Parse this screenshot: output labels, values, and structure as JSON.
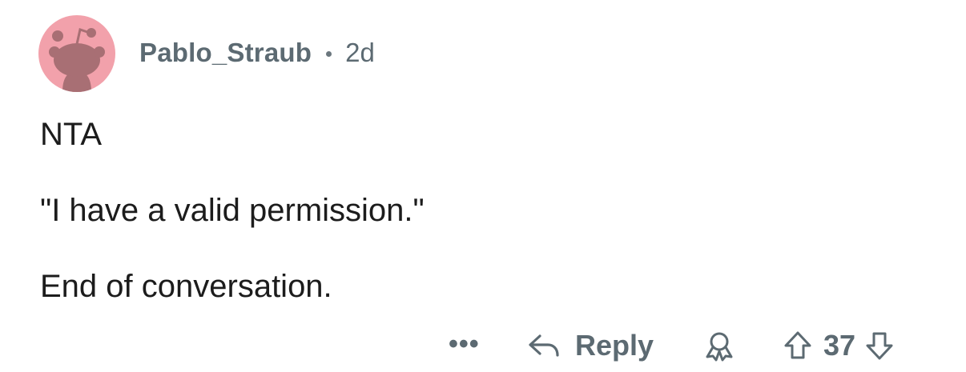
{
  "comment": {
    "author": "Pablo_Straub",
    "age": "2d",
    "paragraphs": [
      "NTA",
      "\"I have a valid permission.\"",
      "End of conversation."
    ]
  },
  "actions": {
    "more_label": "•••",
    "reply_label": "Reply",
    "score": "37",
    "icons": [
      "more-icon",
      "reply-arrow-icon",
      "award-icon",
      "upvote-icon",
      "downvote-icon"
    ]
  },
  "colors": {
    "avatar_bg": "#f2a1ab",
    "avatar_figure": "#a86f74",
    "meta_text": "#5c6a72",
    "body_text": "#1c1c1c"
  }
}
